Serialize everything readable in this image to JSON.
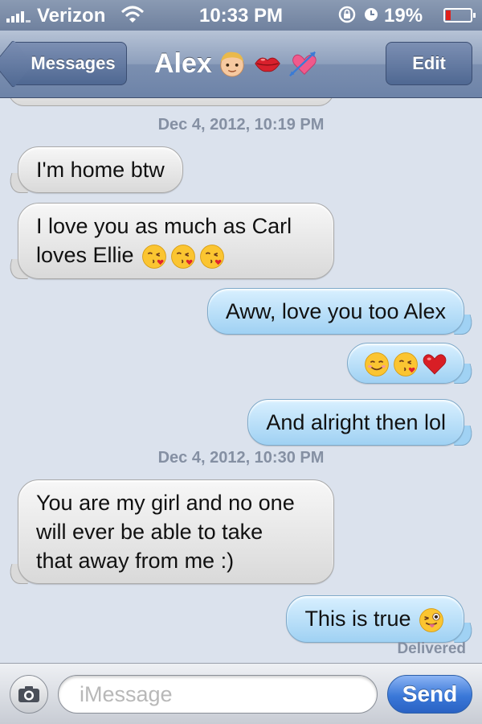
{
  "status_bar": {
    "carrier": "Verizon",
    "time": "10:33 PM",
    "battery_percent": "19%",
    "battery_level": 0.19,
    "battery_color": "#e0201b"
  },
  "nav": {
    "back_label": "Messages",
    "title": "Alex",
    "title_emojis": [
      "boy-face-icon",
      "kiss-lips-icon",
      "heart-with-arrow-icon"
    ],
    "edit_label": "Edit"
  },
  "conversation": {
    "timestamps": [
      "Dec 4, 2012, 10:19 PM",
      "Dec 4, 2012, 10:30 PM"
    ],
    "messages": [
      {
        "direction": "in",
        "text": "I'm home btw"
      },
      {
        "direction": "in",
        "lines": [
          "I love you as much as Carl",
          "loves Ellie"
        ],
        "emojis": [
          "kissing-face-icon",
          "kissing-face-icon",
          "kissing-face-icon"
        ]
      },
      {
        "direction": "out",
        "text": "Aww,  love you too Alex"
      },
      {
        "direction": "out",
        "text": "",
        "emojis": [
          "smiling-face-icon",
          "kissing-face-icon",
          "red-heart-icon"
        ]
      },
      {
        "direction": "out",
        "text": "And alright then lol"
      },
      {
        "direction": "in",
        "lines": [
          "You are my girl and no one",
          "will ever be able to take",
          "that away from me :)"
        ]
      },
      {
        "direction": "out",
        "text": "This is true",
        "emojis": [
          "winking-tongue-face-icon"
        ]
      }
    ],
    "delivered": "Delivered"
  },
  "input_bar": {
    "placeholder": "iMessage",
    "value": "",
    "send_label": "Send"
  },
  "colors": {
    "incoming_bubble": "#e6e6e6",
    "outgoing_bubble": "#b5dcf7",
    "send_button": "#3a78d8",
    "background": "#dbe2ed"
  }
}
